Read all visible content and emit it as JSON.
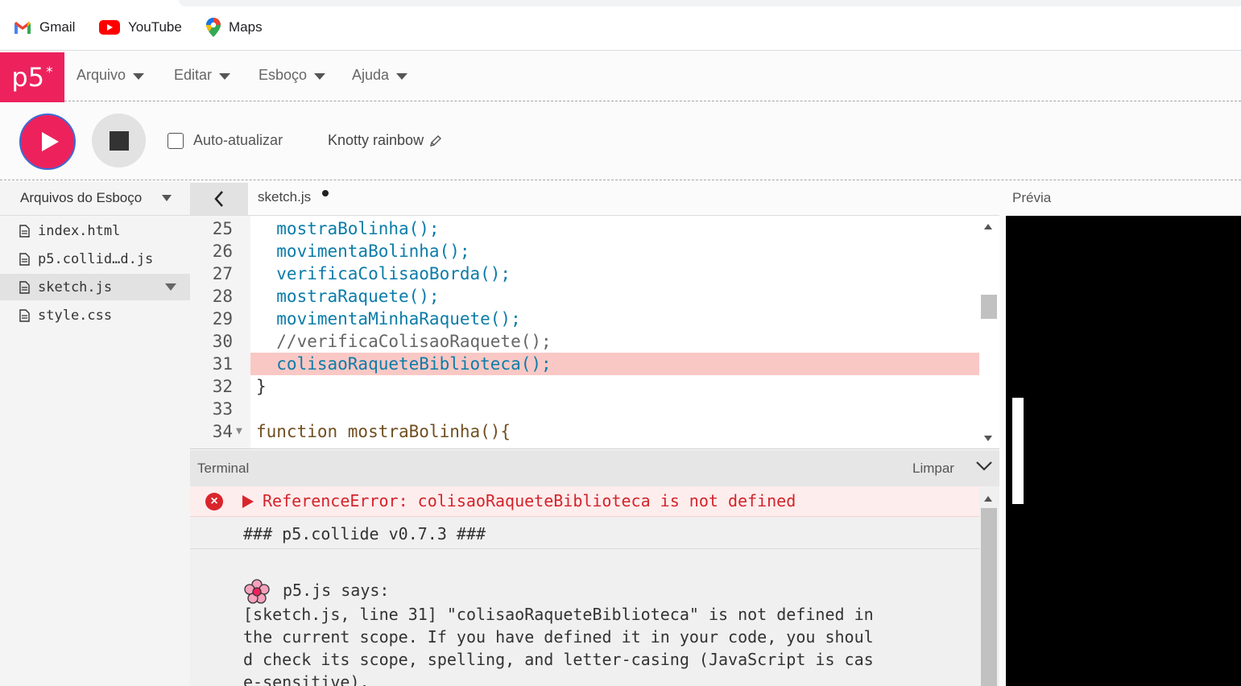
{
  "bookmarks": [
    {
      "label": "Gmail",
      "icon": "gmail-icon"
    },
    {
      "label": "YouTube",
      "icon": "youtube-icon"
    },
    {
      "label": "Maps",
      "icon": "maps-icon"
    }
  ],
  "nav": {
    "logo": "p5",
    "logo_sup": "*",
    "menus": [
      "Arquivo",
      "Editar",
      "Esboço",
      "Ajuda"
    ]
  },
  "toolbar": {
    "auto_update_label": "Auto-atualizar",
    "auto_update_checked": false,
    "sketch_name": "Knotty rainbow"
  },
  "sidebar": {
    "header": "Arquivos do Esboço",
    "files": [
      {
        "name": "index.html",
        "active": false
      },
      {
        "name": "p5.collid…d.js",
        "active": false
      },
      {
        "name": "sketch.js",
        "active": true
      },
      {
        "name": "style.css",
        "active": false
      }
    ]
  },
  "editor": {
    "tab_name": "sketch.js",
    "lines": [
      {
        "number": "25",
        "text": "  mostraBolinha();"
      },
      {
        "number": "26",
        "text": "  movimentaBolinha();"
      },
      {
        "number": "27",
        "text": "  verificaColisaoBorda();"
      },
      {
        "number": "28",
        "text": "  mostraRaquete();"
      },
      {
        "number": "29",
        "text": "  movimentaMinhaRaquete();"
      },
      {
        "number": "30",
        "text": "  //verificaColisaoRaquete();"
      },
      {
        "number": "31",
        "text": "  colisaoRaqueteBiblioteca();"
      },
      {
        "number": "32",
        "text": "}"
      },
      {
        "number": "33",
        "text": ""
      },
      {
        "number": "34",
        "text": "function mostraBolinha(){"
      }
    ],
    "highlighted_line": "31"
  },
  "terminal": {
    "title": "Terminal",
    "clear_label": "Limpar",
    "error": "ReferenceError: colisaoRaqueteBiblioteca is not defined",
    "collide_version": "### p5.collide v0.7.3 ###",
    "fes_says": "p5.js says:",
    "fes_message": "[sketch.js, line 31] \"colisaoRaqueteBiblioteca\" is not defined in\nthe current scope. If you have defined it in your code, you shoul\nd check its scope, spelling, and letter-casing (JavaScript is cas\ne-sensitive)."
  },
  "preview": {
    "title": "Prévia"
  },
  "colors": {
    "accent": "#ed225d",
    "error": "#d9252c",
    "line_highlight": "#f9c8c5",
    "function_name": "#0b7ca9"
  }
}
